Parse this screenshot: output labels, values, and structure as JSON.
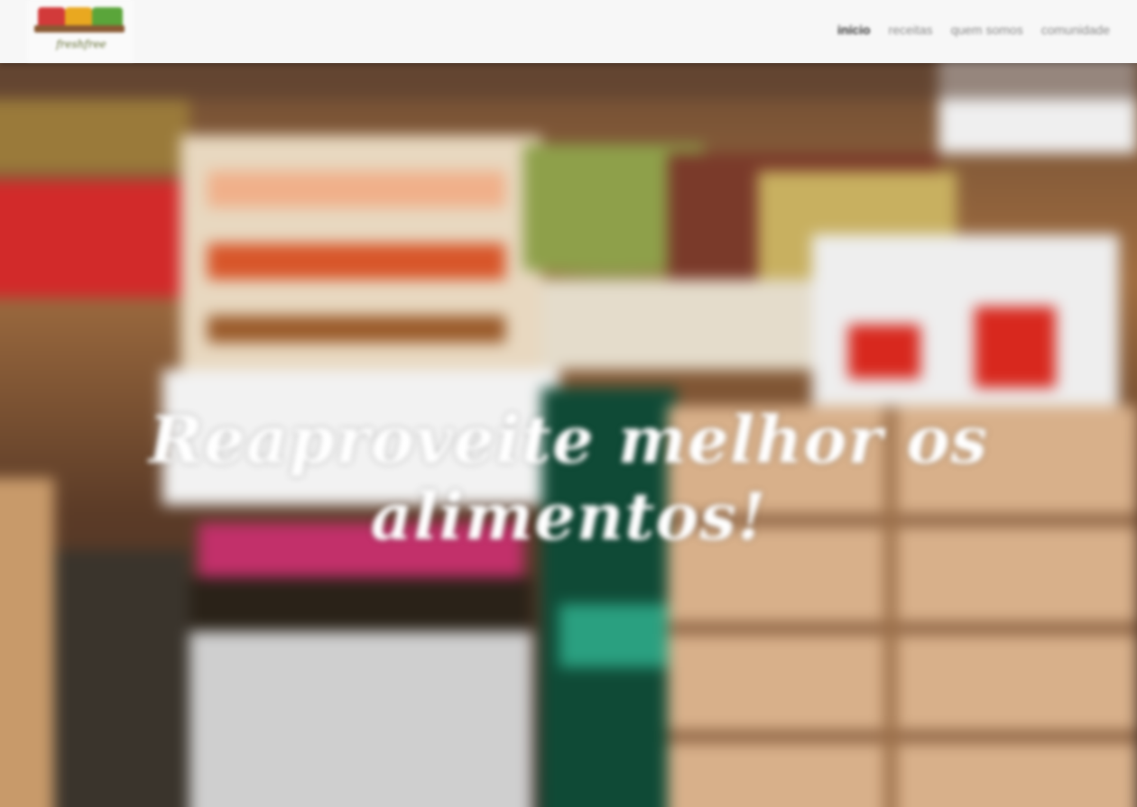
{
  "header": {
    "logo": {
      "wordmark": "freshfree",
      "colors": {
        "red": "#d23a3a",
        "yellow": "#e9a820",
        "green": "#5aa53a"
      }
    },
    "nav": [
      {
        "label": "início",
        "active": true
      },
      {
        "label": "receitas",
        "active": false
      },
      {
        "label": "quem somos",
        "active": false
      },
      {
        "label": "comunidade",
        "active": false
      }
    ]
  },
  "hero": {
    "headline": "Reaproveite melhor os alimentos!",
    "image": "market-produce-crates"
  }
}
